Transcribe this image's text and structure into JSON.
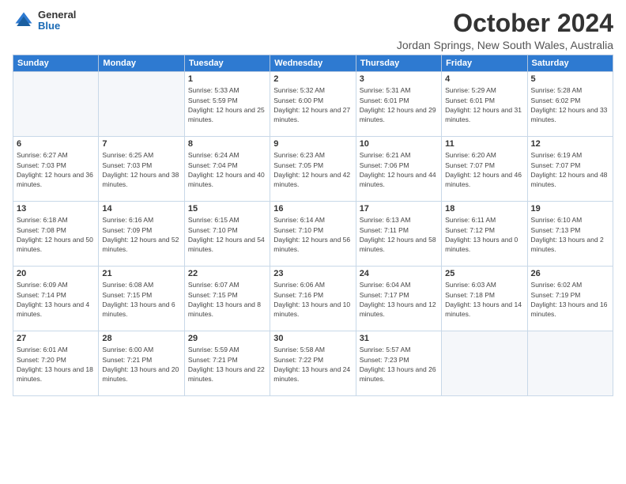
{
  "logo": {
    "general": "General",
    "blue": "Blue"
  },
  "title": "October 2024",
  "subtitle": "Jordan Springs, New South Wales, Australia",
  "weekdays": [
    "Sunday",
    "Monday",
    "Tuesday",
    "Wednesday",
    "Thursday",
    "Friday",
    "Saturday"
  ],
  "weeks": [
    [
      {
        "day": "",
        "sunrise": "",
        "sunset": "",
        "daylight": ""
      },
      {
        "day": "",
        "sunrise": "",
        "sunset": "",
        "daylight": ""
      },
      {
        "day": "1",
        "sunrise": "Sunrise: 5:33 AM",
        "sunset": "Sunset: 5:59 PM",
        "daylight": "Daylight: 12 hours and 25 minutes."
      },
      {
        "day": "2",
        "sunrise": "Sunrise: 5:32 AM",
        "sunset": "Sunset: 6:00 PM",
        "daylight": "Daylight: 12 hours and 27 minutes."
      },
      {
        "day": "3",
        "sunrise": "Sunrise: 5:31 AM",
        "sunset": "Sunset: 6:01 PM",
        "daylight": "Daylight: 12 hours and 29 minutes."
      },
      {
        "day": "4",
        "sunrise": "Sunrise: 5:29 AM",
        "sunset": "Sunset: 6:01 PM",
        "daylight": "Daylight: 12 hours and 31 minutes."
      },
      {
        "day": "5",
        "sunrise": "Sunrise: 5:28 AM",
        "sunset": "Sunset: 6:02 PM",
        "daylight": "Daylight: 12 hours and 33 minutes."
      }
    ],
    [
      {
        "day": "6",
        "sunrise": "Sunrise: 6:27 AM",
        "sunset": "Sunset: 7:03 PM",
        "daylight": "Daylight: 12 hours and 36 minutes."
      },
      {
        "day": "7",
        "sunrise": "Sunrise: 6:25 AM",
        "sunset": "Sunset: 7:03 PM",
        "daylight": "Daylight: 12 hours and 38 minutes."
      },
      {
        "day": "8",
        "sunrise": "Sunrise: 6:24 AM",
        "sunset": "Sunset: 7:04 PM",
        "daylight": "Daylight: 12 hours and 40 minutes."
      },
      {
        "day": "9",
        "sunrise": "Sunrise: 6:23 AM",
        "sunset": "Sunset: 7:05 PM",
        "daylight": "Daylight: 12 hours and 42 minutes."
      },
      {
        "day": "10",
        "sunrise": "Sunrise: 6:21 AM",
        "sunset": "Sunset: 7:06 PM",
        "daylight": "Daylight: 12 hours and 44 minutes."
      },
      {
        "day": "11",
        "sunrise": "Sunrise: 6:20 AM",
        "sunset": "Sunset: 7:07 PM",
        "daylight": "Daylight: 12 hours and 46 minutes."
      },
      {
        "day": "12",
        "sunrise": "Sunrise: 6:19 AM",
        "sunset": "Sunset: 7:07 PM",
        "daylight": "Daylight: 12 hours and 48 minutes."
      }
    ],
    [
      {
        "day": "13",
        "sunrise": "Sunrise: 6:18 AM",
        "sunset": "Sunset: 7:08 PM",
        "daylight": "Daylight: 12 hours and 50 minutes."
      },
      {
        "day": "14",
        "sunrise": "Sunrise: 6:16 AM",
        "sunset": "Sunset: 7:09 PM",
        "daylight": "Daylight: 12 hours and 52 minutes."
      },
      {
        "day": "15",
        "sunrise": "Sunrise: 6:15 AM",
        "sunset": "Sunset: 7:10 PM",
        "daylight": "Daylight: 12 hours and 54 minutes."
      },
      {
        "day": "16",
        "sunrise": "Sunrise: 6:14 AM",
        "sunset": "Sunset: 7:10 PM",
        "daylight": "Daylight: 12 hours and 56 minutes."
      },
      {
        "day": "17",
        "sunrise": "Sunrise: 6:13 AM",
        "sunset": "Sunset: 7:11 PM",
        "daylight": "Daylight: 12 hours and 58 minutes."
      },
      {
        "day": "18",
        "sunrise": "Sunrise: 6:11 AM",
        "sunset": "Sunset: 7:12 PM",
        "daylight": "Daylight: 13 hours and 0 minutes."
      },
      {
        "day": "19",
        "sunrise": "Sunrise: 6:10 AM",
        "sunset": "Sunset: 7:13 PM",
        "daylight": "Daylight: 13 hours and 2 minutes."
      }
    ],
    [
      {
        "day": "20",
        "sunrise": "Sunrise: 6:09 AM",
        "sunset": "Sunset: 7:14 PM",
        "daylight": "Daylight: 13 hours and 4 minutes."
      },
      {
        "day": "21",
        "sunrise": "Sunrise: 6:08 AM",
        "sunset": "Sunset: 7:15 PM",
        "daylight": "Daylight: 13 hours and 6 minutes."
      },
      {
        "day": "22",
        "sunrise": "Sunrise: 6:07 AM",
        "sunset": "Sunset: 7:15 PM",
        "daylight": "Daylight: 13 hours and 8 minutes."
      },
      {
        "day": "23",
        "sunrise": "Sunrise: 6:06 AM",
        "sunset": "Sunset: 7:16 PM",
        "daylight": "Daylight: 13 hours and 10 minutes."
      },
      {
        "day": "24",
        "sunrise": "Sunrise: 6:04 AM",
        "sunset": "Sunset: 7:17 PM",
        "daylight": "Daylight: 13 hours and 12 minutes."
      },
      {
        "day": "25",
        "sunrise": "Sunrise: 6:03 AM",
        "sunset": "Sunset: 7:18 PM",
        "daylight": "Daylight: 13 hours and 14 minutes."
      },
      {
        "day": "26",
        "sunrise": "Sunrise: 6:02 AM",
        "sunset": "Sunset: 7:19 PM",
        "daylight": "Daylight: 13 hours and 16 minutes."
      }
    ],
    [
      {
        "day": "27",
        "sunrise": "Sunrise: 6:01 AM",
        "sunset": "Sunset: 7:20 PM",
        "daylight": "Daylight: 13 hours and 18 minutes."
      },
      {
        "day": "28",
        "sunrise": "Sunrise: 6:00 AM",
        "sunset": "Sunset: 7:21 PM",
        "daylight": "Daylight: 13 hours and 20 minutes."
      },
      {
        "day": "29",
        "sunrise": "Sunrise: 5:59 AM",
        "sunset": "Sunset: 7:21 PM",
        "daylight": "Daylight: 13 hours and 22 minutes."
      },
      {
        "day": "30",
        "sunrise": "Sunrise: 5:58 AM",
        "sunset": "Sunset: 7:22 PM",
        "daylight": "Daylight: 13 hours and 24 minutes."
      },
      {
        "day": "31",
        "sunrise": "Sunrise: 5:57 AM",
        "sunset": "Sunset: 7:23 PM",
        "daylight": "Daylight: 13 hours and 26 minutes."
      },
      {
        "day": "",
        "sunrise": "",
        "sunset": "",
        "daylight": ""
      },
      {
        "day": "",
        "sunrise": "",
        "sunset": "",
        "daylight": ""
      }
    ]
  ]
}
